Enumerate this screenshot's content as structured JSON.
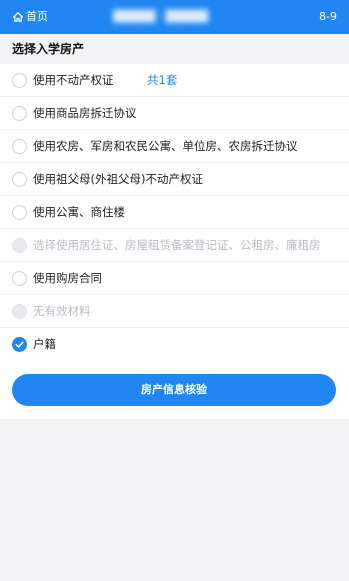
{
  "topbar": {
    "home_label": "首页",
    "home_icon": "home-icon",
    "title_blurred": "█████ · █████",
    "code": "8-9"
  },
  "section": {
    "title": "选择入学房产"
  },
  "options": [
    {
      "label": "使用不动产权证",
      "extra": "共1套",
      "state": "unchecked"
    },
    {
      "label": "使用商品房拆迁协议",
      "state": "unchecked"
    },
    {
      "label": "使用农房、军房和农民公寓、单位房、农房拆迁协议",
      "state": "unchecked"
    },
    {
      "label": "使用祖父母(外祖父母)不动产权证",
      "state": "unchecked"
    },
    {
      "label": "使用公寓、商住楼",
      "state": "unchecked"
    },
    {
      "label": "选择使用居住证、房屋租赁备案登记证、公租房、廉租房",
      "state": "disabled"
    },
    {
      "label": "使用购房合同",
      "state": "unchecked"
    },
    {
      "label": "无有效材料",
      "state": "disabled"
    },
    {
      "label": "户籍",
      "state": "checked"
    }
  ],
  "footer": {
    "button_label": "房产信息核验"
  },
  "colors": {
    "primary": "#1f86f2",
    "disabled_text": "#b8bcc4",
    "background": "#f2f3f5"
  }
}
